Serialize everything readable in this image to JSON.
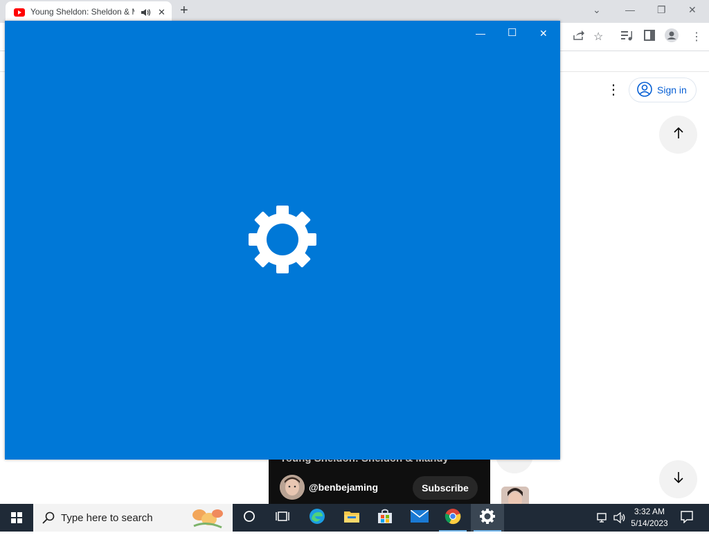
{
  "browser": {
    "tab_title": "Young Sheldon: Sheldon & M",
    "tab_icons": [
      "youtube-favicon",
      "speaker-icon",
      "close-icon"
    ],
    "new_tab_label": "+",
    "window_controls": [
      "minimize-icon",
      "maximize-icon",
      "close-icon"
    ],
    "toolbar_icons": [
      "share-icon",
      "star-icon",
      "media-icon",
      "side-panel-icon",
      "profile-icon",
      "kebab-menu-icon"
    ]
  },
  "youtube": {
    "more_label": "⋮",
    "sign_in_label": "Sign in",
    "video_title": "Young Sheldon: Sheldon & Mandy",
    "channel_name": "@benbejaming",
    "subscribe_label": "Subscribe",
    "nav_icons": [
      "arrow-up-icon",
      "arrow-down-icon"
    ]
  },
  "settings_window": {
    "background": "#0078d7",
    "icon": "gear-icon",
    "controls": {
      "minimize": "—",
      "maximize": "☐",
      "close": "✕"
    }
  },
  "taskbar": {
    "search_placeholder": "Type here to search",
    "apps": [
      "cortana-icon",
      "task-view-icon",
      "edge-icon",
      "file-explorer-icon",
      "store-icon",
      "mail-icon",
      "chrome-icon",
      "settings-icon"
    ],
    "clock_time": "3:32 AM",
    "clock_date": "5/14/2023"
  },
  "colors": {
    "accent": "#0078d7",
    "taskbar": "#1f2a37",
    "youtube_red": "#ff0000",
    "link_blue": "#065fd4"
  }
}
